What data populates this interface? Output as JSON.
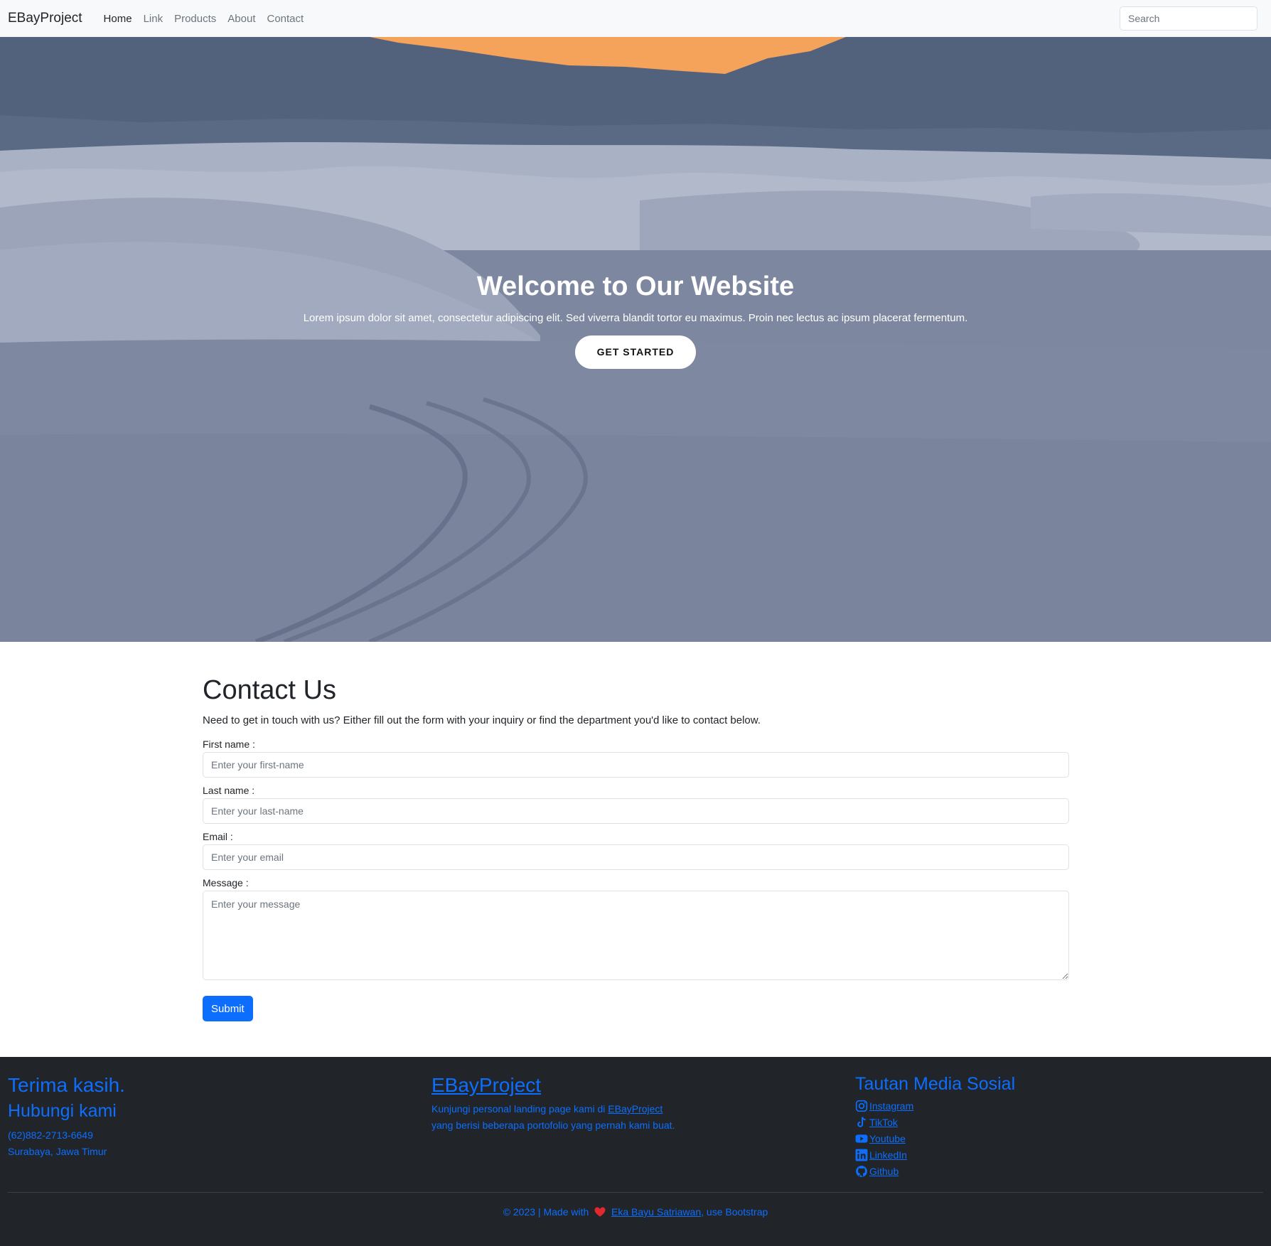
{
  "navbar": {
    "brand": "EBayProject",
    "links": [
      "Home",
      "Link",
      "Products",
      "About",
      "Contact"
    ],
    "active": "Home",
    "search_placeholder": "Search"
  },
  "hero": {
    "title": "Welcome to Our Website",
    "subtitle": "Lorem ipsum dolor sit amet, consectetur adipiscing elit. Sed viverra blandit tortor eu maximus. Proin nec lectus ac ipsum placerat fermentum.",
    "button_label": "GET STARTED"
  },
  "contact": {
    "title": "Contact Us",
    "intro": "Need to get in touch with us? Either fill out the form with your inquiry or find the department you'd like to contact below.",
    "first_name_label": "First name :",
    "first_name_placeholder": "Enter your first-name",
    "last_name_label": "Last name :",
    "last_name_placeholder": "Enter your last-name",
    "email_label": "Email :",
    "email_placeholder": "Enter your email",
    "message_label": "Message :",
    "message_placeholder": "Enter your message",
    "submit_label": "Submit"
  },
  "footer": {
    "thanks": "Terima kasih.",
    "contact_heading": "Hubungi kami",
    "phone": "(62)882-2713-6649",
    "address": "Surabaya, Jawa Timur",
    "brand": "EBayProject",
    "desc_prefix": "Kunjungi personal landing page kami di ",
    "desc_link": "EBayProject",
    "desc_line2": "yang berisi beberapa portofolio yang pernah kami buat.",
    "social_title": "Tautan Media Sosial",
    "social": [
      {
        "label": "Instagram",
        "icon": "instagram-icon"
      },
      {
        "label": "TikTok",
        "icon": "tiktok-icon"
      },
      {
        "label": "Youtube",
        "icon": "youtube-icon"
      },
      {
        "label": "LinkedIn",
        "icon": "linkedin-icon"
      },
      {
        "label": "Github",
        "icon": "github-icon"
      }
    ],
    "copyright_prefix": "© 2023 | Made with",
    "author": "Eka Bayu Satriawan",
    "copyright_suffix": ", use Bootstrap"
  },
  "colors": {
    "primary": "#0d6efd",
    "footer_bg": "#212529",
    "navbar_bg": "#f8f9fa",
    "sunset": "#f5a25a",
    "heart": "#e0282e"
  }
}
